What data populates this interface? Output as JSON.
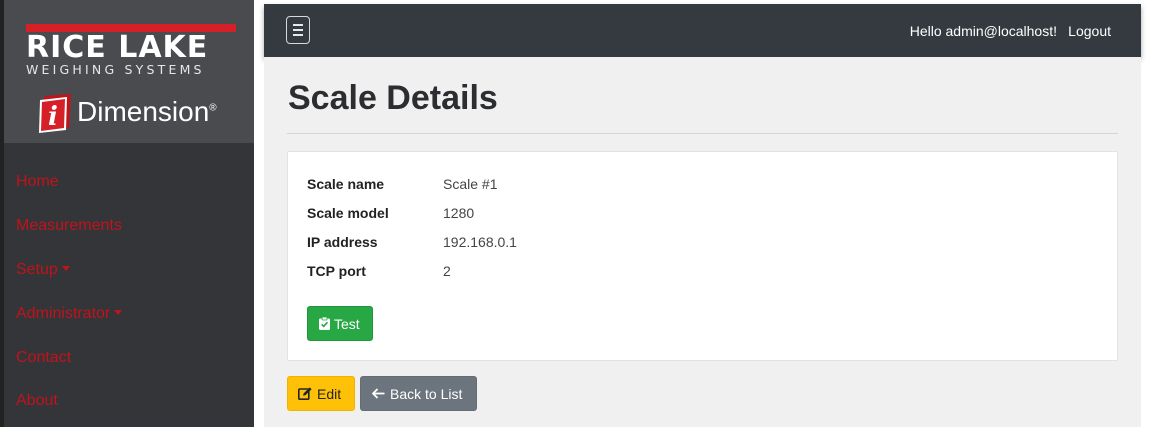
{
  "brand": {
    "company_name": "RICE LAKE",
    "company_tagline": "WEIGHING SYSTEMS",
    "product_mark": "i",
    "product_name": "Dimension",
    "product_trademark": "®"
  },
  "sidebar": {
    "items": [
      {
        "label": "Home"
      },
      {
        "label": "Measurements"
      },
      {
        "label": "Setup"
      },
      {
        "label": "Administrator"
      },
      {
        "label": "Contact"
      },
      {
        "label": "About"
      }
    ]
  },
  "topbar": {
    "greeting": "Hello admin@localhost!",
    "logout_label": "Logout"
  },
  "page": {
    "title": "Scale Details"
  },
  "details": [
    {
      "label": "Scale name",
      "value": "Scale #1"
    },
    {
      "label": "Scale model",
      "value": "1280"
    },
    {
      "label": "IP address",
      "value": "192.168.0.1"
    },
    {
      "label": "TCP port",
      "value": "2"
    }
  ],
  "actions": {
    "test_label": "Test",
    "edit_label": "Edit",
    "back_label": "Back to List"
  },
  "colors": {
    "sidebar_bg": "#333539",
    "nav_link": "#c0131b",
    "brand_red": "#d62027",
    "topbar_bg": "#343a40",
    "success": "#28a745",
    "warning": "#ffc107",
    "secondary": "#6c757d"
  },
  "icons": {
    "menu": "hamburger-menu-icon",
    "test": "clipboard-check-icon",
    "edit": "edit-icon",
    "back": "arrow-left-icon",
    "dropdown": "caret-down-icon"
  }
}
